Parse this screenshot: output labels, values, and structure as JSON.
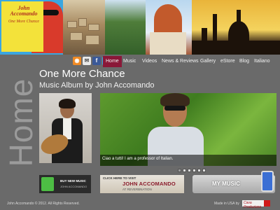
{
  "logo": {
    "name_line1": "John",
    "name_line2": "Accomando",
    "tagline": "One More Chance"
  },
  "social": [
    "rss-icon",
    "email-icon",
    "facebook-icon",
    "twitter-icon"
  ],
  "nav": {
    "items": [
      {
        "label": "Home",
        "active": true
      },
      {
        "label": "Music"
      },
      {
        "label": "Videos"
      },
      {
        "label": "News & Reviews"
      },
      {
        "label": "Gallery"
      },
      {
        "label": "eStore"
      },
      {
        "label": "Blog"
      },
      {
        "label": "Italiano"
      }
    ],
    "active_color": "#8a1838"
  },
  "page": {
    "vertical_title": "Home",
    "title": "One More Chance",
    "subtitle": "Music Album by John Accomando"
  },
  "slider": {
    "caption": "Ciao a tutti! I am a professor of Italian.",
    "dots": 6,
    "active_dot": 1
  },
  "banners": {
    "buy": {
      "line1": "BUY NEW MUSIC",
      "line2": "JOHN ACCOMANDO"
    },
    "visit": {
      "line1": "CLICK HERE TO VISIT",
      "line2": "JOHN ACCOMANDO",
      "line3": "AT REVERBNATION"
    },
    "mymusic": {
      "label": "MY MUSIC"
    }
  },
  "footer": {
    "copyright": "John Accomando © 2012. All Rights Reserved.",
    "made_in": "Made in USA by",
    "brand": "Cava Produzione"
  }
}
